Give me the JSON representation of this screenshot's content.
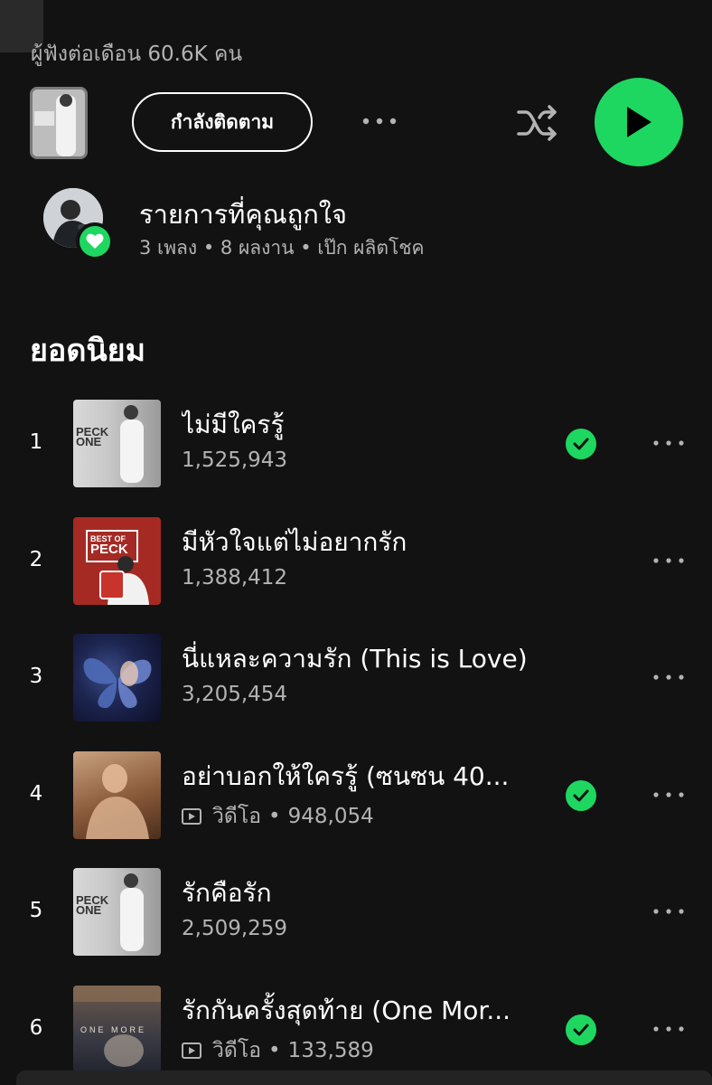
{
  "header": {
    "monthly_listeners": "ผู้ฟังต่อเดือน 60.6K คน"
  },
  "controls": {
    "follow_label": "กำลังติดตาม",
    "play_color": "#1ed760"
  },
  "liked_songs": {
    "title": "รายการที่คุณถูกใจ",
    "subtitle": "3 เพลง • 8 ผลงาน • เป๊ก ผลิตโชค"
  },
  "popular": {
    "title": "ยอดนิยม",
    "tracks": [
      {
        "rank": "1",
        "name": "ไม่มีใครรู้",
        "plays": "1,525,943",
        "video": false,
        "liked": true,
        "cover": "peck-one"
      },
      {
        "rank": "2",
        "name": "มีหัวใจแต่ไม่อยากรัก",
        "plays": "1,388,412",
        "video": false,
        "liked": false,
        "cover": "best-of-peck"
      },
      {
        "rank": "3",
        "name": "นี่แหละความรัก (This is Love)",
        "plays": "3,205,454",
        "video": false,
        "liked": false,
        "cover": "butterfly"
      },
      {
        "rank": "4",
        "name": "อย่าบอกให้ใครรู้ (ซนซน 40...",
        "plays": "948,054",
        "video": true,
        "video_label": "วิดีโอ",
        "liked": true,
        "cover": "dont-tell"
      },
      {
        "rank": "5",
        "name": "รักคือรัก",
        "plays": "2,509,259",
        "video": false,
        "liked": false,
        "cover": "peck-one"
      },
      {
        "rank": "6",
        "name": "รักกันครั้งสุดท้าย (One Mor...",
        "plays": "133,589",
        "video": true,
        "video_label": "วิดีโอ",
        "liked": true,
        "cover": "one-more"
      }
    ],
    "cover_text": {
      "peck": "PECK",
      "one": "ONE",
      "best_of": "BEST OF",
      "one_more": "ONE MORE"
    }
  },
  "colors": {
    "background": "#121212",
    "accent": "#1ed760",
    "secondary_text": "#b3b3b3"
  }
}
